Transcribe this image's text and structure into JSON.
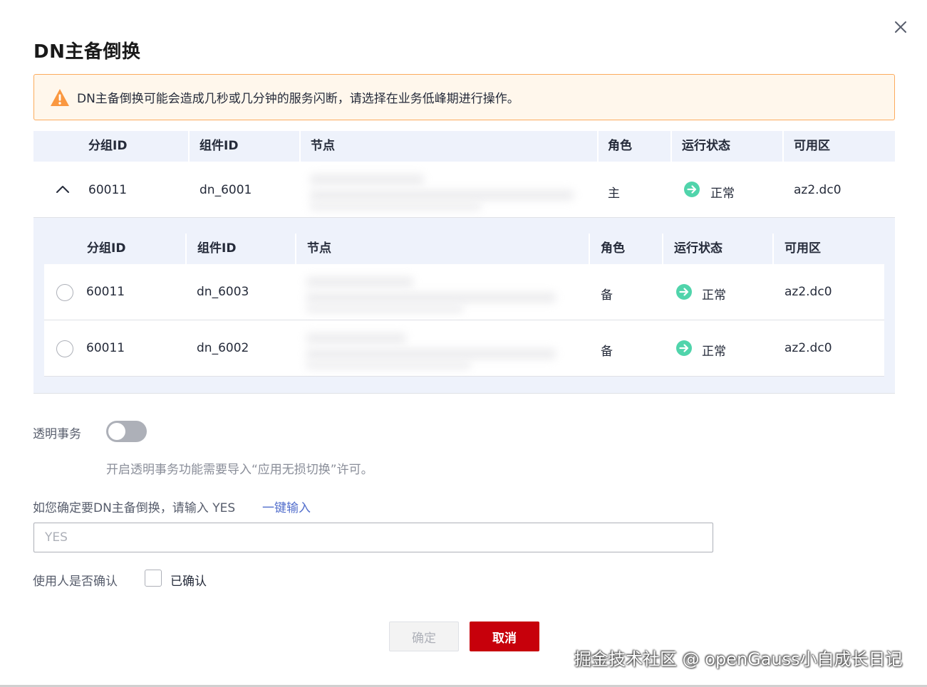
{
  "dialog": {
    "title": "DN主备倒换",
    "close_icon": "close-icon"
  },
  "alert": {
    "icon": "warning-icon",
    "text": "DN主备倒换可能会造成几秒或几分钟的服务闪断，请选择在业务低峰期进行操作。",
    "color": "#fcab5d"
  },
  "table": {
    "headers": {
      "group_id": "分组ID",
      "component_id": "组件ID",
      "node": "节点",
      "role": "角色",
      "status": "运行状态",
      "az": "可用区"
    },
    "primary": {
      "group_id": "60011",
      "component_id": "dn_6001",
      "role": "主",
      "status": "正常",
      "az": "az2.dc0"
    },
    "standbys": [
      {
        "group_id": "60011",
        "component_id": "dn_6003",
        "role": "备",
        "status": "正常",
        "az": "az2.dc0"
      },
      {
        "group_id": "60011",
        "component_id": "dn_6002",
        "role": "备",
        "status": "正常",
        "az": "az2.dc0"
      }
    ],
    "status_color": "#50d4ab"
  },
  "form": {
    "transparent_tx_label": "透明事务",
    "transparent_tx_hint": "开启透明事务功能需要导入“应用无损切换”许可。",
    "confirm_prompt": "如您确定要DN主备倒换，请输入  YES",
    "one_click_link": "一键输入",
    "confirm_input_placeholder": "YES",
    "user_confirm_label": "使用人是否确认",
    "confirmed_checkbox_label": "已确认"
  },
  "buttons": {
    "ok": "确定",
    "cancel": "取消",
    "cancel_color": "#c7000b"
  },
  "watermark": "掘金技术社区 @ openGauss小白成长日记"
}
